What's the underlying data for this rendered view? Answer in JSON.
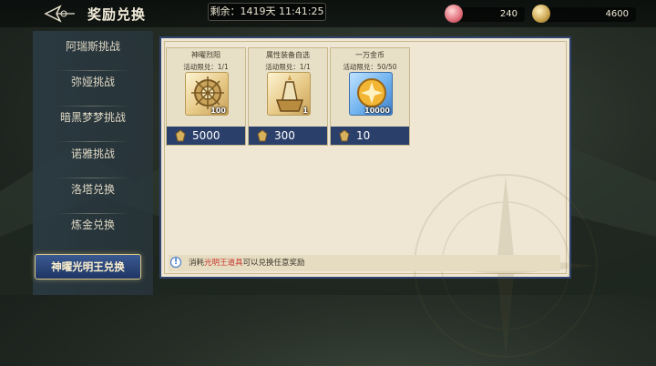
{
  "header": {
    "title": "奖励兑换",
    "timer": "剩余：1419天 11:41:25"
  },
  "currencies": [
    {
      "icon": "pink-gem-icon",
      "value": "240"
    },
    {
      "icon": "gold-emblem-icon",
      "value": "4600"
    }
  ],
  "sidebar": {
    "items": [
      {
        "label": "阿瑞斯挑战"
      },
      {
        "label": "弥娅挑战"
      },
      {
        "label": "暗黑梦梦挑战"
      },
      {
        "label": "诺雅挑战"
      },
      {
        "label": "洛塔兑换"
      },
      {
        "label": "炼金兑换"
      }
    ],
    "active": {
      "label": "神曜光明王兑换"
    }
  },
  "rewards": [
    {
      "name": "神曜烈阳",
      "limit": "活动限兑：1/1",
      "qty": "100",
      "price": "5000",
      "icon": "sun-gear-icon"
    },
    {
      "name": "属性装备自选",
      "limit": "活动限兑：1/1",
      "qty": "1",
      "price": "300",
      "icon": "equipment-chest-icon"
    },
    {
      "name": "一万金币",
      "limit": "活动限兑：50/50",
      "qty": "10000",
      "price": "10",
      "icon": "gold-coin-icon"
    }
  ],
  "notice": {
    "prefix": "消耗",
    "highlight": "光明王道具",
    "suffix": "可以兑换任意奖励"
  },
  "colors": {
    "accent": "#2b3f6b",
    "highlight": "#c73b2f",
    "active_tab": "#2d4a80"
  }
}
